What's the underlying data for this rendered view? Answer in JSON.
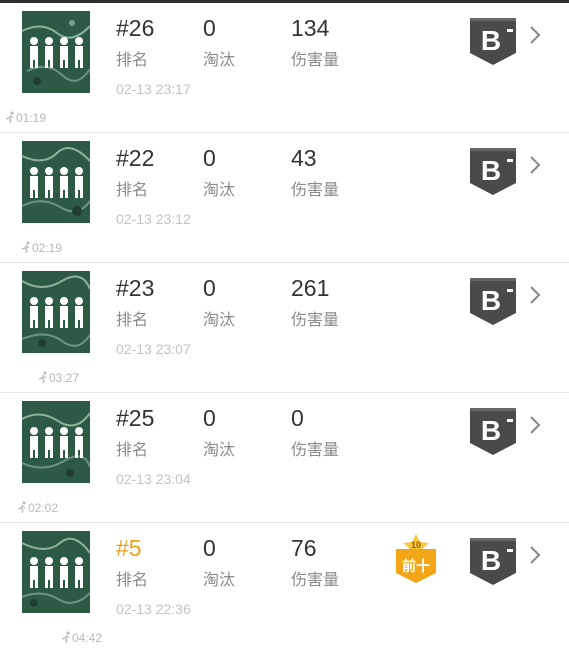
{
  "matches": [
    {
      "rank": "#26",
      "kills": "0",
      "damage": "134",
      "time": "02-13 23:17",
      "duration": "01:19",
      "grade": "B",
      "top_ten": false
    },
    {
      "rank": "#22",
      "kills": "0",
      "damage": "43",
      "time": "02-13 23:12",
      "duration": "02:19",
      "grade": "B",
      "top_ten": false
    },
    {
      "rank": "#23",
      "kills": "0",
      "damage": "261",
      "time": "02-13 23:07",
      "duration": "03:27",
      "grade": "B",
      "top_ten": false
    },
    {
      "rank": "#25",
      "kills": "0",
      "damage": "0",
      "time": "02-13 23:04",
      "duration": "02:02",
      "grade": "B",
      "top_ten": false
    },
    {
      "rank": "#5",
      "kills": "0",
      "damage": "76",
      "time": "02-13 22:36",
      "duration": "04:42",
      "grade": "B",
      "top_ten": true,
      "badge_top": "10",
      "badge_label": "前十"
    }
  ],
  "labels": {
    "rank": "排名",
    "kills": "淘汰",
    "damage": "伤害量"
  },
  "colors": {
    "top_rank": "#e8a01e",
    "grade_badge": "#4a4a4a",
    "medal": "#f2a516",
    "map_green": "#2d5a44"
  },
  "icons": {
    "map": "map-squad-icon",
    "grade": "grade-b-icon",
    "duration": "running-man-icon",
    "chevron": "chevron-right-icon",
    "medal": "top-ten-medal-icon"
  }
}
